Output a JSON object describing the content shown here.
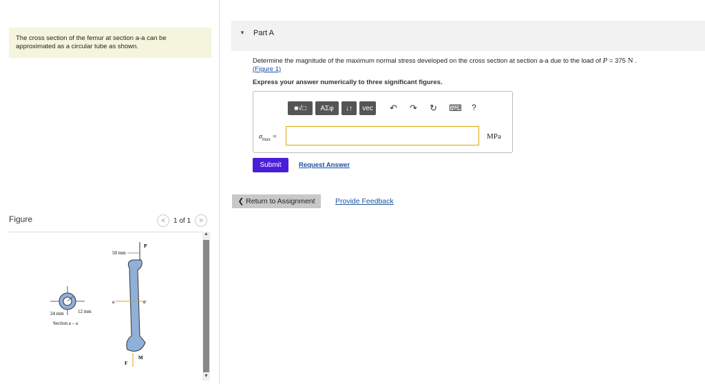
{
  "intro": {
    "line1": "The cross section of the femur at section a-a can be",
    "line2": "approximated as a circular tube as shown."
  },
  "figure_panel": {
    "label": "Figure",
    "pager_text": "1 of 1",
    "prev": "<",
    "next": ">",
    "labels": {
      "top_dim": "50 mm",
      "load": "P",
      "section_a_left": "a",
      "section_a_right": "a",
      "dim_outer": "24 mm",
      "dim_inner": "12 mm",
      "section_caption": "Section a – a",
      "force_f": "F",
      "moment_m": "M"
    }
  },
  "part": {
    "title": "Part A",
    "question_text": "Determine the magnitude of the maximum normal stress developed on the cross section at section a-a due to the load of ",
    "p_symbol": "P",
    "p_value": " = 375 ",
    "p_unit": "N",
    "period": " .",
    "figure_link": "(Figure 1)",
    "express": "Express your answer numerically to three significant figures."
  },
  "answer": {
    "toolbar": {
      "templates": "■√□",
      "greek": "ΑΣφ",
      "arrows": "↓↑",
      "vec": "vec",
      "undo": "↶",
      "redo": "↷",
      "reset": "↻",
      "keyboard": "⌨",
      "help": "?"
    },
    "sigma_symbol": "σ",
    "sigma_sub": "max",
    "equals": " =",
    "input_value": "",
    "unit": "MPa"
  },
  "actions": {
    "submit": "Submit",
    "request_answer": "Request Answer",
    "return": "❮ Return to Assignment",
    "feedback": "Provide Feedback"
  },
  "colors": {
    "submit_bg": "#4a1ed9",
    "link": "#1a4fa0",
    "intro_bg": "#f4f5dc",
    "input_border": "#d9a500"
  }
}
